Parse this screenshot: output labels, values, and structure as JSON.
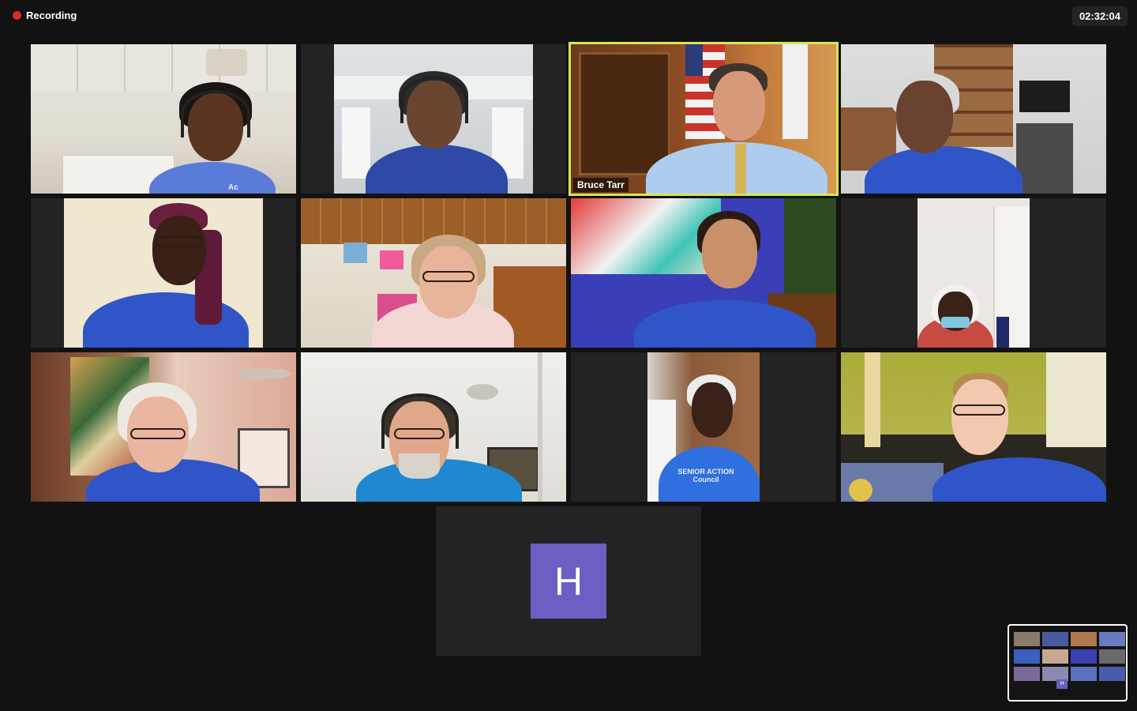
{
  "topbar": {
    "recording_label": "Recording",
    "timer": "02:32:04"
  },
  "colors": {
    "background": "#121212",
    "recording_dot": "#e02a2a",
    "active_speaker_border": "#d6e65a",
    "shirt_blue": "#2f55c9",
    "avatar_bg": "#6a5fc2"
  },
  "participants": [
    {
      "name_label": "",
      "speaking": false
    },
    {
      "name_label": "",
      "speaking": false
    },
    {
      "name_label": "Bruce Tarr",
      "speaking": true
    },
    {
      "name_label": "",
      "speaking": false
    },
    {
      "name_label": "",
      "speaking": false
    },
    {
      "name_label": "",
      "speaking": false
    },
    {
      "name_label": "",
      "speaking": false
    },
    {
      "name_label": "",
      "speaking": false
    },
    {
      "name_label": "",
      "speaking": false
    },
    {
      "name_label": "",
      "speaking": false
    },
    {
      "name_label": "",
      "speaking": false
    },
    {
      "name_label": "",
      "speaking": false
    },
    {
      "name_label": "",
      "speaking": false
    }
  ],
  "avatar_tile": {
    "initial": "H"
  },
  "self_view": {
    "icon": "gallery-thumbnail-icon",
    "initial": "H"
  },
  "shirt_texts": {
    "tile1": "Ac",
    "tile11_line1": "SENIOR ACTION",
    "tile11_line2": "Council"
  }
}
